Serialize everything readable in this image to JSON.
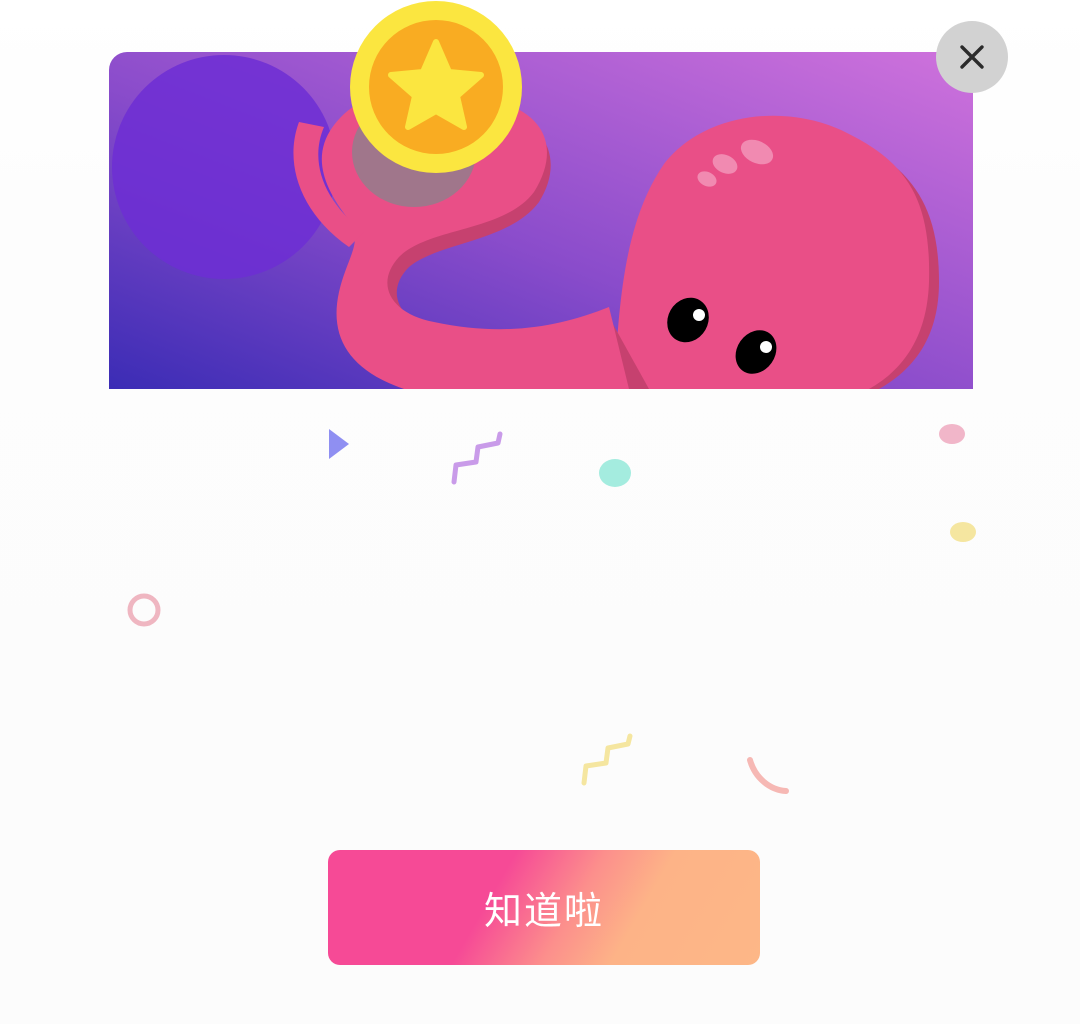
{
  "dialog": {
    "confirm_label": "知道啦",
    "close_icon": "close-icon",
    "illustration": "octopus-holding-coin",
    "coin_icon": "star-coin-icon"
  },
  "colors": {
    "banner_gradient_start": "#3b2cb5",
    "banner_gradient_end": "#cf72dc",
    "octopus": "#e94f87",
    "coin_outer": "#fbe640",
    "coin_inner": "#f9ac22",
    "button_gradient_start": "#f64a96",
    "button_gradient_end": "#fdb787",
    "close_button_bg": "#d2d2d2"
  }
}
